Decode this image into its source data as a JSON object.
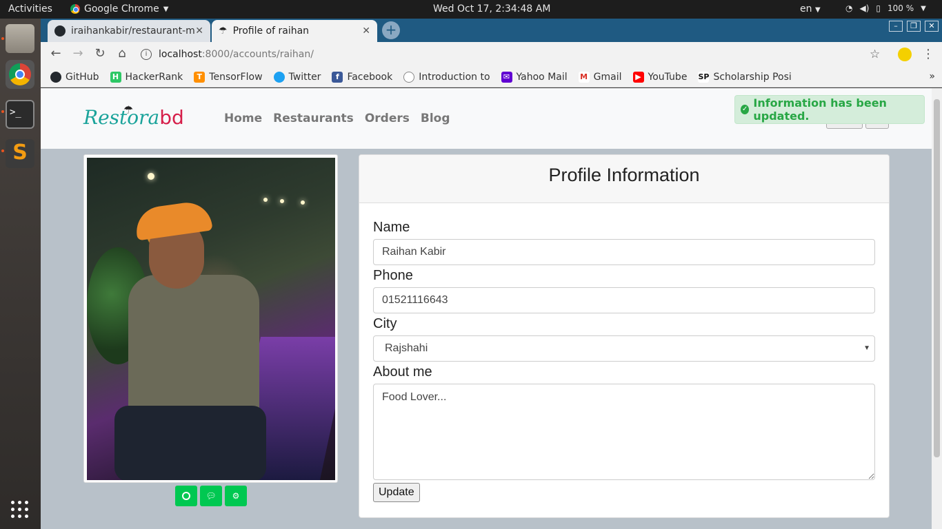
{
  "system_bar": {
    "activities": "Activities",
    "app_name": "Google Chrome",
    "clock": "Wed Oct 17,  2:34:48 AM",
    "lang": "en",
    "battery": "100 %"
  },
  "browser": {
    "tabs": [
      {
        "title": "iraihankabir/restaurant-m",
        "active": false
      },
      {
        "title": "Profile of raihan",
        "active": true
      }
    ],
    "url_host": "localhost",
    "url_path": ":8000/accounts/raihan/",
    "bookmarks": [
      {
        "label": "GitHub",
        "icon": "github-icon",
        "color": "#24292e"
      },
      {
        "label": "HackerRank",
        "icon": "hackerrank-icon",
        "color": "#2ec866"
      },
      {
        "label": "TensorFlow",
        "icon": "tensorflow-icon",
        "color": "#ff8f00"
      },
      {
        "label": "Twitter",
        "icon": "twitter-icon",
        "color": "#1da1f2"
      },
      {
        "label": "Facebook",
        "icon": "facebook-icon",
        "color": "#3b5998"
      },
      {
        "label": "Introduction to",
        "icon": "course-icon",
        "color": "#888888"
      },
      {
        "label": "Yahoo Mail",
        "icon": "yahoo-mail-icon",
        "color": "#6001d2"
      },
      {
        "label": "Gmail",
        "icon": "gmail-icon",
        "color": "#d93025"
      },
      {
        "label": "YouTube",
        "icon": "youtube-icon",
        "color": "#ff0000"
      },
      {
        "label": "Scholarship Posi",
        "icon": "scholarship-icon",
        "color": "#111111"
      }
    ]
  },
  "site": {
    "logo_main": "Res",
    "logo_mid": "tora",
    "logo_end": "bd",
    "nav": [
      "Home",
      "Restaurants",
      "Orders",
      "Blog"
    ],
    "alert": "Information has been updated."
  },
  "profile": {
    "card_title": "Profile Information",
    "name_label": "Name",
    "name_value": "Raihan Kabir",
    "phone_label": "Phone",
    "phone_value": "01521116643",
    "city_label": "City",
    "city_value": "Rajshahi",
    "about_label": "About me",
    "about_value": "Food Lover...",
    "update_label": "Update"
  },
  "colors": {
    "accent_green": "#00c851",
    "alert_text": "#28a745",
    "tabstrip": "#1f5a82",
    "logo_teal": "#1aa39a",
    "logo_red": "#d61f4a"
  }
}
